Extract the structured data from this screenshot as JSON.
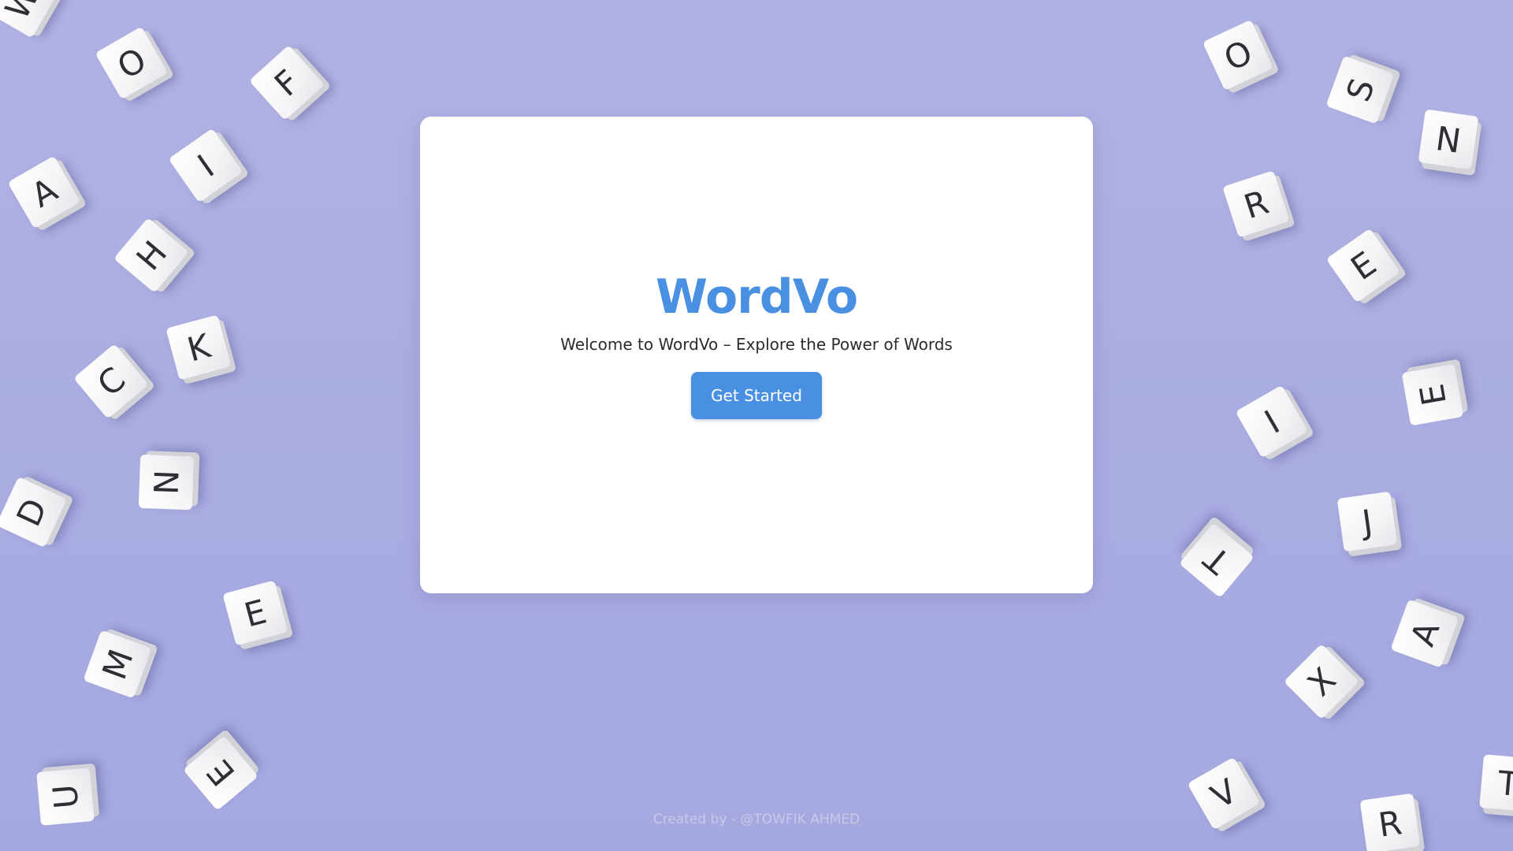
{
  "app": {
    "title": "WordVo",
    "subtitle": "Welcome to WordVo – Explore the Power of Words",
    "cta_label": "Get Started",
    "footer_credit": "Created by - @TOWFIK AHMED"
  },
  "colors": {
    "background": "#abaee2",
    "accent": "#4a90e2",
    "card": "#ffffff",
    "title": "#4a90e2",
    "body_text": "#2b2b2b",
    "footer_text": "#c8c8e8"
  },
  "background_tiles": {
    "letters": [
      "W",
      "O",
      "F",
      "I",
      "A",
      "H",
      "K",
      "C",
      "N",
      "D",
      "E",
      "M",
      "U",
      "E",
      "O",
      "S",
      "N",
      "R",
      "E",
      "E",
      "I",
      "J",
      "T",
      "A",
      "X",
      "V",
      "R",
      "T"
    ]
  }
}
